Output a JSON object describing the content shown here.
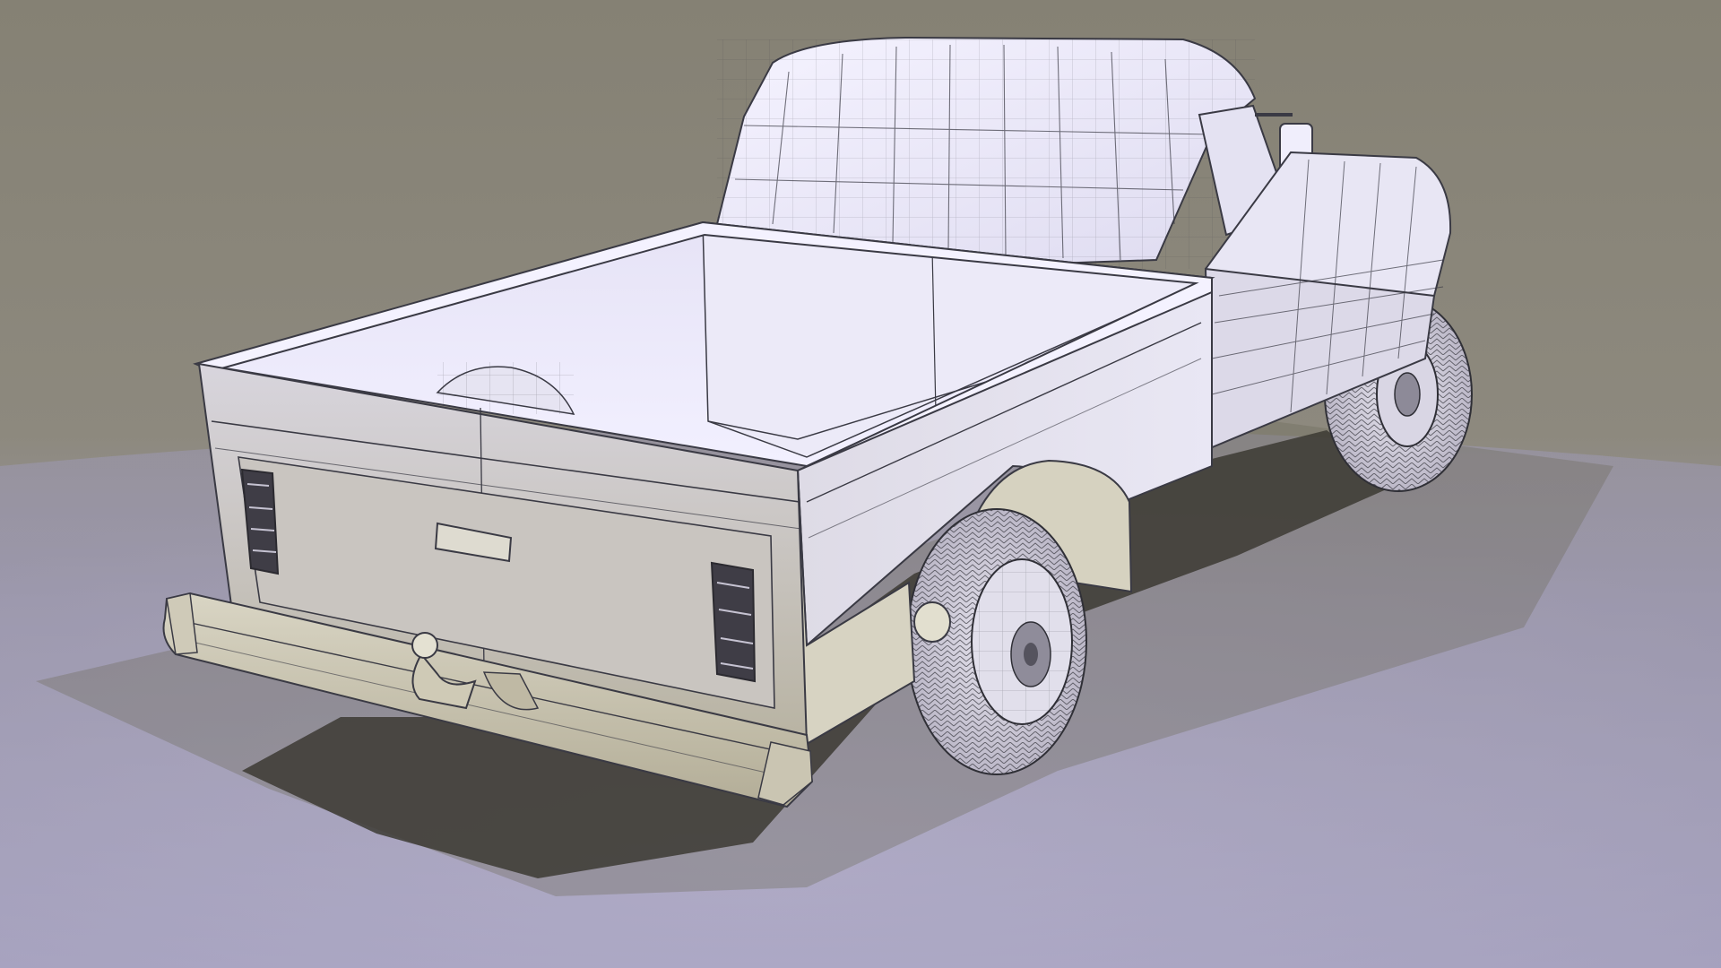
{
  "scene": {
    "subject": "pickup-truck-wireframe-render",
    "view": "rear-three-quarter",
    "colors": {
      "backdrop_top": "#8a8678",
      "backdrop_mid": "#8c8880",
      "floor_far": "#a29fb6",
      "floor_near": "#aeaac8",
      "clay_light": "#f3f1ff",
      "clay_mid": "#dddbea",
      "clay_warm": "#cdc8b6",
      "clay_shadow": "#9f9a86",
      "shadow": "#4a4640",
      "wire": "#3a3a40"
    }
  }
}
